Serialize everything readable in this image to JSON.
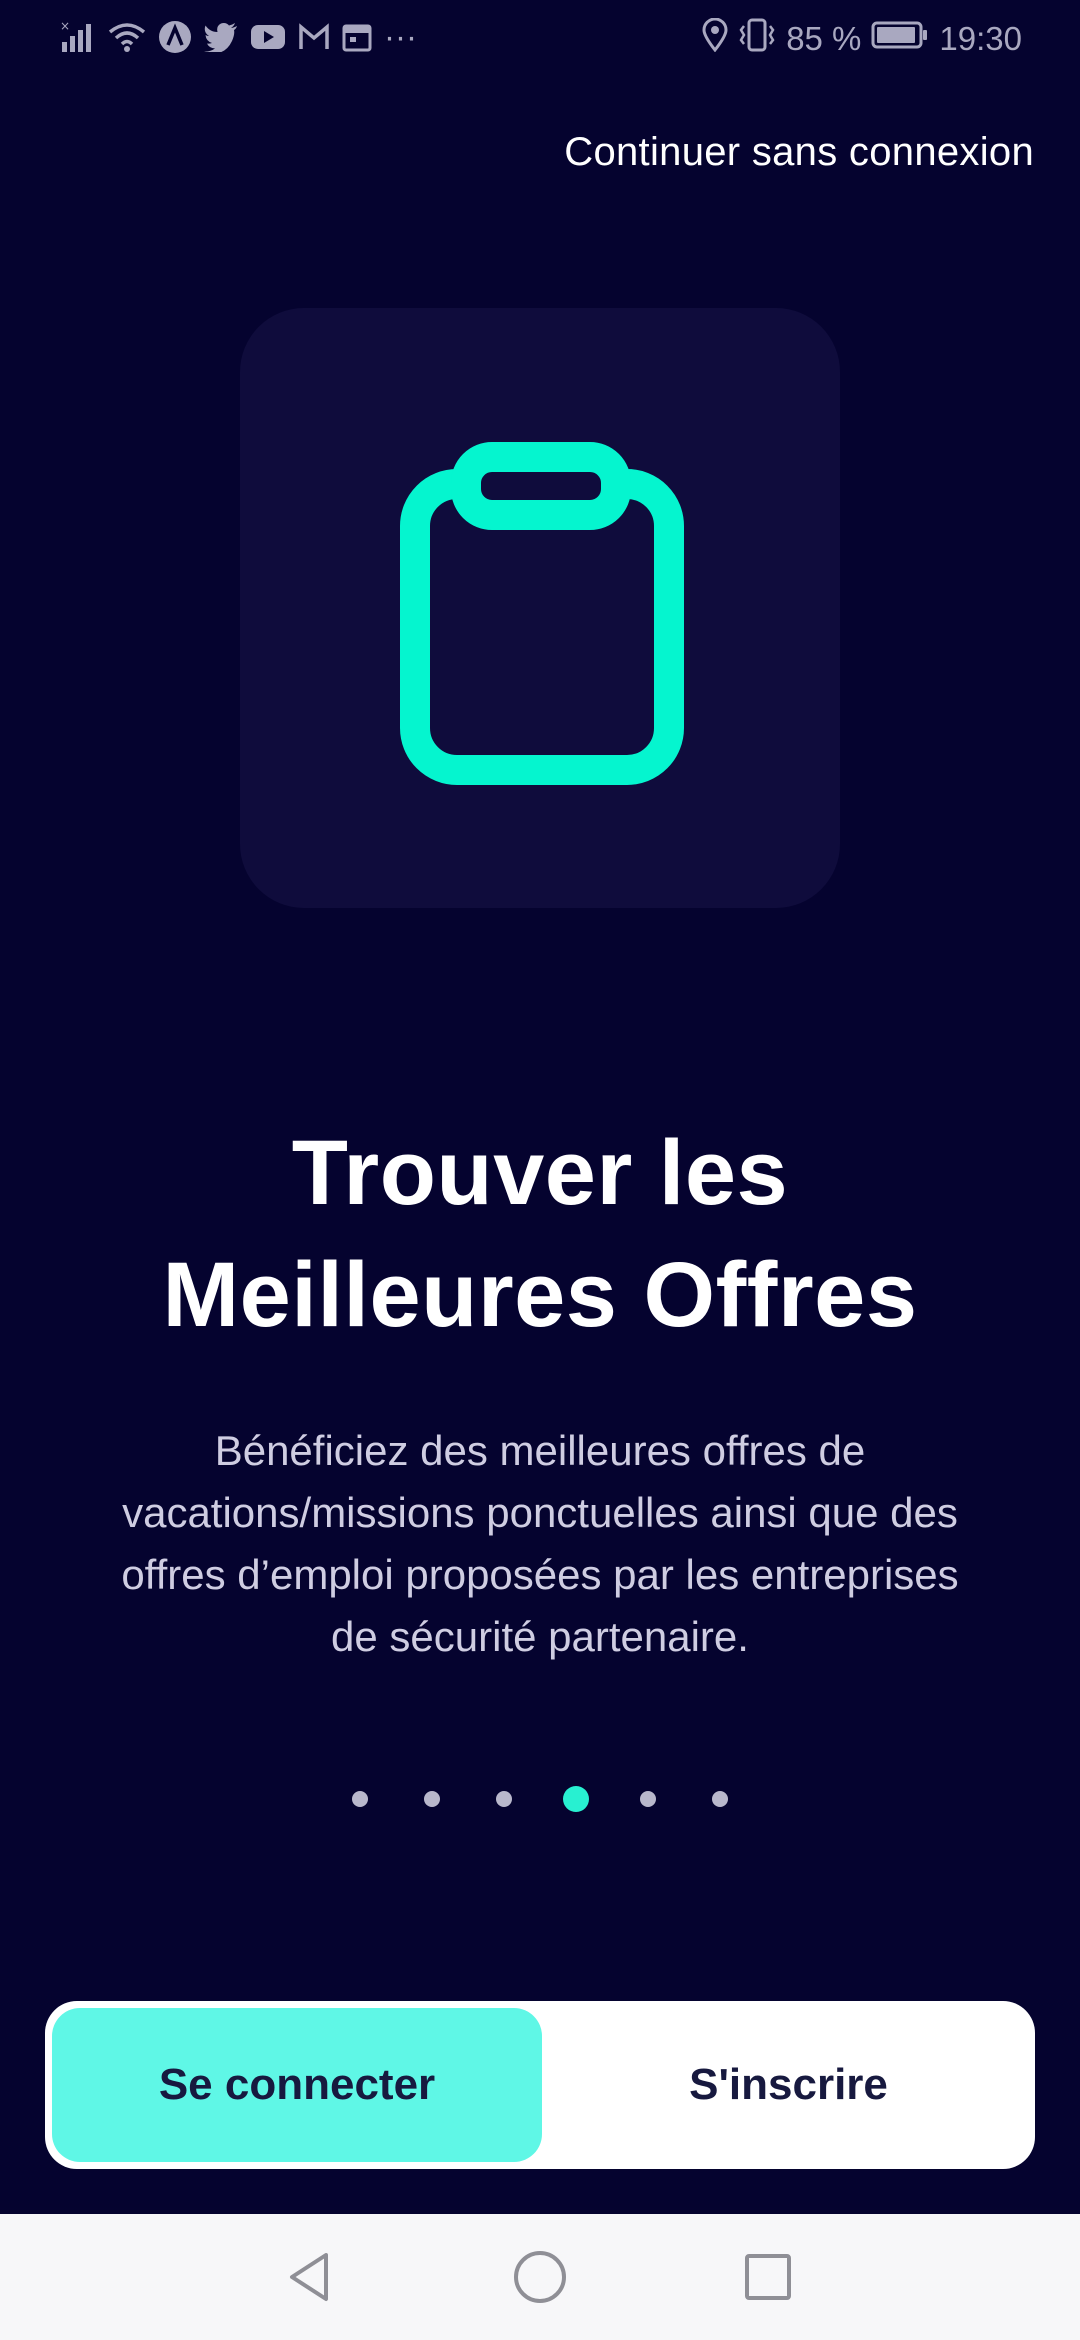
{
  "status_bar": {
    "battery_percent": "85 %",
    "time": "19:30",
    "more": "···"
  },
  "header": {
    "skip_label": "Continuer sans connexion"
  },
  "onboarding": {
    "illustration_icon": "clipboard-icon",
    "title_line1": "Trouver les",
    "title_line2": "Meilleures Offres",
    "description": "Bénéficiez des meilleures offres de vacations/missions ponctuelles ainsi que des offres d’emploi proposées par les entreprises de sécurité partenaire.",
    "page_count": 6,
    "current_page": 4
  },
  "auth": {
    "login_label": "Se connecter",
    "signup_label": "S'inscrire"
  },
  "colors": {
    "background": "#05032f",
    "card": "#0f0c3c",
    "accent": "#28f0d1",
    "login_button": "#5ff7e6"
  },
  "nav": {
    "back_icon": "back-triangle-icon",
    "home_icon": "home-circle-icon",
    "recents_icon": "recents-square-icon"
  }
}
